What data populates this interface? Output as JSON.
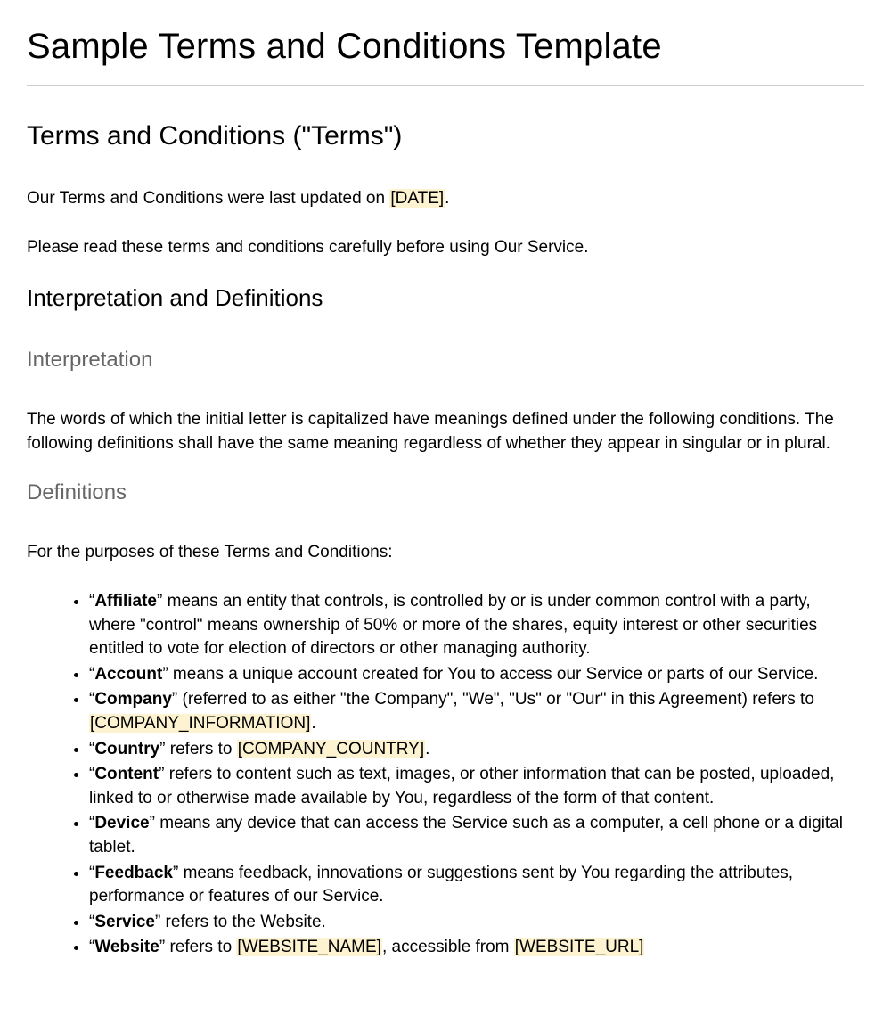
{
  "title": "Sample Terms and Conditions Template",
  "h2_terms": "Terms and Conditions (\"Terms\")",
  "intro": {
    "line1_prefix": "Our Terms and Conditions were last updated on ",
    "date_placeholder": "[DATE]",
    "line1_suffix": ".",
    "line2": "Please read these terms and conditions carefully before using Our Service."
  },
  "h2_interp": "Interpretation and Definitions",
  "h3_interpretation": "Interpretation",
  "interp_body": "The words of which the initial letter is capitalized have meanings defined under the following conditions. The following definitions shall have the same meaning regardless of whether they appear in singular or in plural.",
  "h3_definitions": "Definitions",
  "defs_intro": "For the purposes of these Terms and Conditions:",
  "defs": {
    "affiliate": {
      "term": "Affiliate",
      "text": " means an entity that controls, is controlled by or is under common control with a party, where \"control\" means ownership of 50% or more of the shares, equity interest or other securities entitled to vote for election of directors or other managing authority."
    },
    "account": {
      "term": "Account",
      "text": " means a unique account created for You to access our Service or parts of our Service."
    },
    "company": {
      "term": "Company",
      "text_before": " (referred to as either \"the Company\", \"We\", \"Us\" or \"Our\" in this Agreement) refers to ",
      "placeholder": "[COMPANY_INFORMATION]",
      "text_after": "."
    },
    "country": {
      "term": "Country",
      "text_before": " refers to ",
      "placeholder": "[COMPANY_COUNTRY]",
      "text_after": "."
    },
    "content": {
      "term": "Content",
      "text": " refers to content such as text, images, or other information that can be posted, uploaded, linked to or otherwise made available by You, regardless of the form of that content."
    },
    "device": {
      "term": "Device",
      "text": " means any device that can access the Service such as a computer, a cell phone or a digital tablet."
    },
    "feedback": {
      "term": "Feedback",
      "text": " means feedback, innovations or suggestions sent by You regarding the attributes, performance or features of our Service."
    },
    "service": {
      "term": "Service",
      "text": " refers to the Website."
    },
    "website": {
      "term": "Website",
      "text_before": " refers to ",
      "placeholder_name": "[WEBSITE_NAME]",
      "mid": ", accessible from ",
      "placeholder_url": "[WEBSITE_URL]"
    }
  }
}
